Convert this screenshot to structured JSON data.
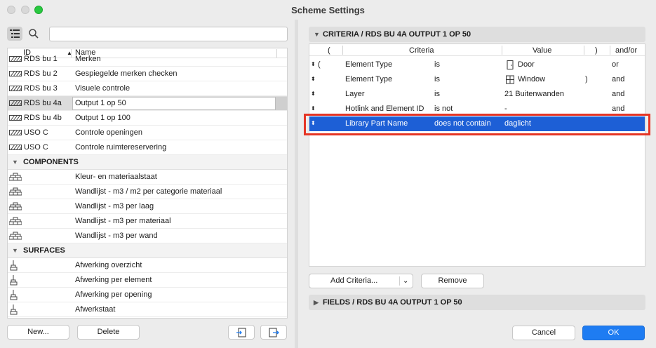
{
  "window": {
    "title": "Scheme Settings"
  },
  "left": {
    "search": {
      "value": "",
      "placeholder": ""
    },
    "columns": {
      "id": "ID",
      "name": "Name"
    },
    "rows_top": [
      {
        "id": "RDS bu 1",
        "name": "Merken"
      },
      {
        "id": "RDS bu 2",
        "name": "Gespiegelde merken checken"
      },
      {
        "id": "RDS bu 3",
        "name": "Visuele controle"
      },
      {
        "id": "RDS bu 4a",
        "name": "Output 1 op  50"
      },
      {
        "id": "RDS bu 4b",
        "name": "Output 1 op 100"
      },
      {
        "id": "USO C",
        "name": "Controle openingen"
      },
      {
        "id": "USO C",
        "name": "Controle ruimtereservering"
      }
    ],
    "components_label": "COMPONENTS",
    "components": [
      {
        "name": "Kleur- en materiaalstaat"
      },
      {
        "name": "Wandlijst - m3 / m2 per categorie materiaal"
      },
      {
        "name": "Wandlijst - m3 per laag"
      },
      {
        "name": "Wandlijst - m3 per materiaal"
      },
      {
        "name": "Wandlijst - m3 per wand"
      }
    ],
    "surfaces_label": "SURFACES",
    "surfaces": [
      {
        "name": "Afwerking overzicht"
      },
      {
        "name": "Afwerking per element"
      },
      {
        "name": "Afwerking per opening"
      },
      {
        "name": "Afwerkstaat"
      }
    ],
    "buttons": {
      "new": "New...",
      "delete": "Delete"
    }
  },
  "right": {
    "criteria_title": "CRITERIA / RDS BU 4A OUTPUT 1 OP  50",
    "columns": {
      "open": "(",
      "criteria": "Criteria",
      "value": "Value",
      "close": ")",
      "andor": "and/or"
    },
    "rows": [
      {
        "open": "(",
        "criteria": "Element Type",
        "op": "is",
        "value": "Door",
        "close": "",
        "andor": "or"
      },
      {
        "open": "",
        "criteria": "Element Type",
        "op": "is",
        "value": "Window",
        "close": ")",
        "andor": "and"
      },
      {
        "open": "",
        "criteria": "Layer",
        "op": "is",
        "value": "21 Buitenwanden",
        "close": "",
        "andor": "and"
      },
      {
        "open": "",
        "criteria": "Hotlink and Element ID",
        "op": "is not",
        "value": "-",
        "close": "",
        "andor": "and"
      },
      {
        "open": "",
        "criteria": "Library Part Name",
        "op": "does not contain",
        "value": "daglicht",
        "close": "",
        "andor": ""
      }
    ],
    "add_criteria_label": "Add Criteria...",
    "remove_label": "Remove",
    "fields_title": "FIELDS / RDS BU 4A OUTPUT 1 OP  50",
    "cancel_label": "Cancel",
    "ok_label": "OK"
  },
  "colors": {
    "selection": "#1d5fd6",
    "highlight": "#e53525",
    "ok_button": "#1e7cf2"
  }
}
